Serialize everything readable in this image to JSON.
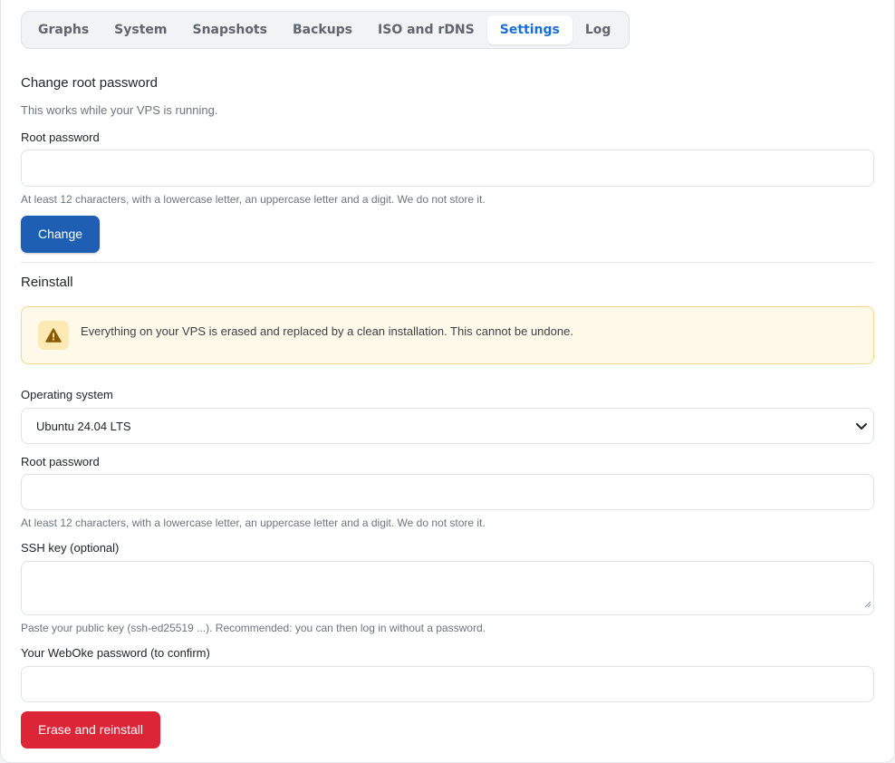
{
  "tabs": [
    {
      "label": "Graphs",
      "active": false
    },
    {
      "label": "System",
      "active": false
    },
    {
      "label": "Snapshots",
      "active": false
    },
    {
      "label": "Backups",
      "active": false
    },
    {
      "label": "ISO and rDNS",
      "active": false
    },
    {
      "label": "Settings",
      "active": true
    },
    {
      "label": "Log",
      "active": false
    }
  ],
  "change_password": {
    "title": "Change root password",
    "subtitle": "This works while your VPS is running.",
    "field_label": "Root password",
    "field_value": "",
    "help": "At least 12 characters, with a lowercase letter, an uppercase letter and a digit. We do not store it.",
    "button_label": "Change"
  },
  "reinstall": {
    "title": "Reinstall",
    "alert_icon": "warning-triangle-icon",
    "alert_text": "Everything on your VPS is erased and replaced by a clean installation. This cannot be undone.",
    "os_label": "Operating system",
    "os_selected": "Ubuntu 24.04 LTS",
    "password_label": "Root password",
    "password_value": "",
    "password_help": "At least 12 characters, with a lowercase letter, an uppercase letter and a digit. We do not store it.",
    "ssh_label": "SSH key (optional)",
    "ssh_value": "",
    "ssh_help": "Paste your public key (ssh-ed25519 ...). Recommended: you can then log in without a password.",
    "confirm_label": "Your WebOke password (to confirm)",
    "confirm_value": "",
    "button_label": "Erase and reinstall"
  },
  "colors": {
    "accent": "#1a6fd6",
    "primary_button": "#1f5fb3",
    "danger_button": "#dc2537",
    "warning_bg": "#fff9ea",
    "warning_border": "#f3d98a"
  }
}
